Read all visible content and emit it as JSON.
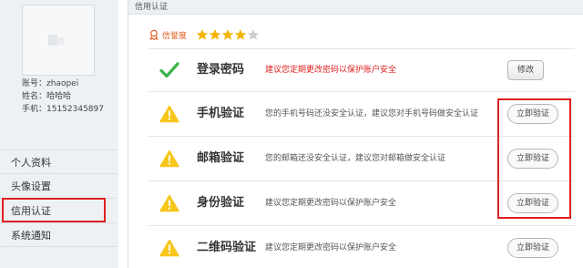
{
  "sidebar": {
    "account_line": "账号：zhaopei",
    "name_line": "姓名：哈哈哈",
    "phone_line": "手机：15152345897",
    "menu": [
      {
        "label": "个人资料"
      },
      {
        "label": "头像设置"
      },
      {
        "label": "信用认证"
      },
      {
        "label": "系统通知"
      }
    ],
    "highlight_color": "#e02020"
  },
  "main": {
    "title": "信用认证",
    "credit": {
      "label": "信誉度",
      "rating": 4,
      "max_rating": 5,
      "star_color": "#f5b400",
      "star_empty_color": "#cccccc",
      "icon": "medal-icon"
    },
    "rows": [
      {
        "name": "登录密码",
        "desc": "建议您定期更改密码以保护账户安全",
        "status": "ok",
        "button": "修改"
      },
      {
        "name": "手机验证",
        "desc": "您的手机号码还没安全认证，建议您对手机号码做安全认证",
        "status": "warning",
        "button": "立即验证"
      },
      {
        "name": "邮箱验证",
        "desc": "您的邮箱还没安全认证，建议您对邮箱做安全认证",
        "status": "warning",
        "button": "立即验证"
      },
      {
        "name": "身份验证",
        "desc": "建议您定期更改密码以保护账户安全",
        "status": "warning",
        "button": "立即验证"
      },
      {
        "name": "二维码验证",
        "desc": "建议您定期更改密码以保护账户安全",
        "status": "warning",
        "button": "立即验证"
      }
    ],
    "colors": {
      "ok": "#3bb34a",
      "warning": "#f7c61a",
      "warn_text": "#e02020"
    }
  }
}
